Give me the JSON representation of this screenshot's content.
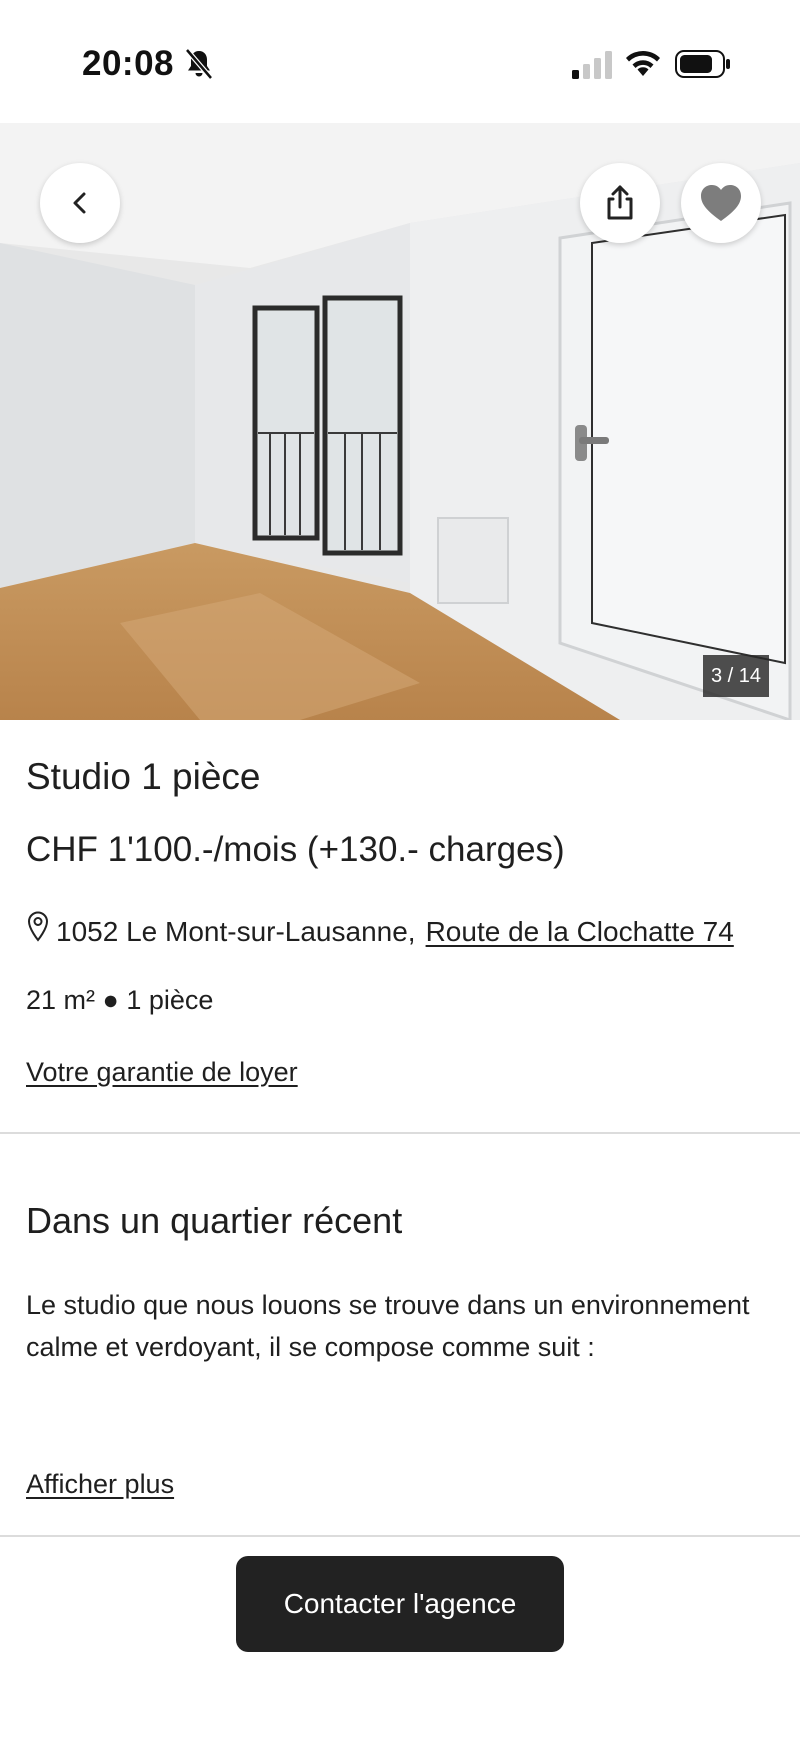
{
  "status_bar": {
    "time": "20:08",
    "icons": [
      "bell-slash-icon",
      "signal-icon",
      "wifi-icon",
      "battery-icon"
    ]
  },
  "gallery": {
    "counter": "3 / 14",
    "buttons": [
      "back-icon",
      "share-icon",
      "heart-icon"
    ]
  },
  "listing": {
    "title": "Studio 1 pièce",
    "price": "CHF 1'100.-/mois (+130.- charges)",
    "address_locality": "1052 Le Mont-sur-Lausanne,",
    "address_street": "Route de la Clochatte 74",
    "specs": "21 m² ● 1 pièce",
    "guarantee_link": "Votre garantie de loyer"
  },
  "description": {
    "heading": "Dans un quartier récent",
    "text": "Le studio que nous louons se trouve dans un environnement calme et verdoyant, il se compose comme suit :",
    "more_link": "Afficher plus"
  },
  "cta": {
    "label": "Contacter l'agence"
  },
  "colors": {
    "text": "#1f1f1f",
    "cta_background": "#222222",
    "divider": "#dcdcdc"
  }
}
